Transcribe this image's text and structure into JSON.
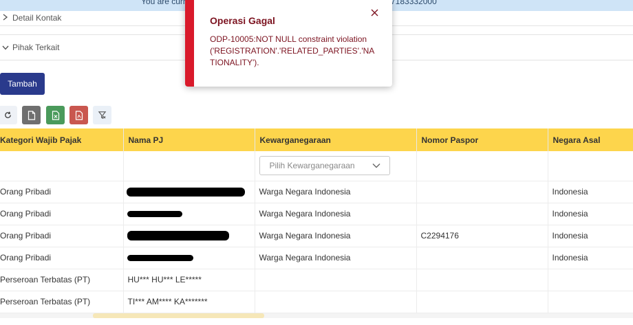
{
  "banner": {
    "text_left": "You are curr",
    "text_right": "7183332000"
  },
  "sections": {
    "detail_kontak": "Detail Kontak",
    "pihak_terkait": "Pihak Terkait"
  },
  "actions": {
    "tambah_label": "Tambah"
  },
  "toolbar": {
    "icons": [
      "refresh-icon",
      "document-icon",
      "excel-icon",
      "pdf-icon",
      "filter-off-icon"
    ]
  },
  "table": {
    "columns": [
      "Kategori Wajib Pajak",
      "Nama PJ",
      "Kewarganegaraan",
      "Nomor Paspor",
      "Negara Asal"
    ],
    "filter_placeholder": "Pilih Kewarganegaraan",
    "rows": [
      {
        "kategori": "Orang Pribadi",
        "nama": "",
        "kewarganegaraan": "Warga Negara Indonesia",
        "paspor": "",
        "negara": "Indonesia"
      },
      {
        "kategori": "Orang Pribadi",
        "nama": "",
        "kewarganegaraan": "Warga Negara Indonesia",
        "paspor": "",
        "negara": "Indonesia"
      },
      {
        "kategori": "Orang Pribadi",
        "nama": "",
        "kewarganegaraan": "Warga Negara Indonesia",
        "paspor": "C2294176",
        "negara": "Indonesia"
      },
      {
        "kategori": "Orang Pribadi",
        "nama": "",
        "kewarganegaraan": "Warga Negara Indonesia",
        "paspor": "",
        "negara": "Indonesia"
      },
      {
        "kategori": "Perseroan Terbatas (PT)",
        "nama": "HU*** HU*** LE*****",
        "kewarganegaraan": "",
        "paspor": "",
        "negara": ""
      },
      {
        "kategori": "Perseroan Terbatas (PT)",
        "nama": "TI*** AM**** KA*******",
        "kewarganegaraan": "",
        "paspor": "",
        "negara": ""
      }
    ]
  },
  "toast": {
    "title": "Operasi Gagal",
    "message": "ODP-10005:NOT NULL constraint violation ('REGISTRATION'.'RELATED_PARTIES'.'NATIONALITY').",
    "accent_color": "#d91a2b",
    "text_color": "#7c1320"
  },
  "colors": {
    "header_bg": "#fdd54c",
    "primary_button": "#2a3a8c",
    "banner_bg": "#cfe4f7"
  }
}
